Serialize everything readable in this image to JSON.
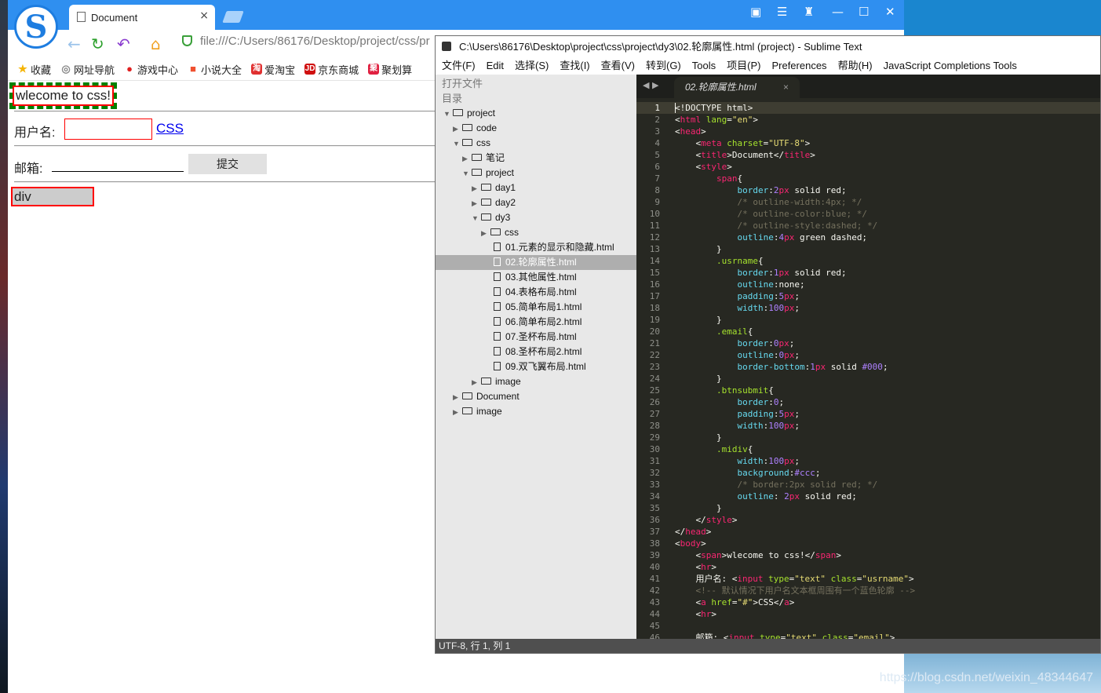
{
  "browser": {
    "tab_title": "Document",
    "tab_close": "×",
    "url": "file:///C:/Users/86176/Desktop/project/css/pr",
    "bookmarks": [
      {
        "label": "收藏",
        "icon": "star-icon",
        "color": "#f5b400"
      },
      {
        "label": "网址导航",
        "icon": "globe-icon",
        "color": "#888888"
      },
      {
        "label": "游戏中心",
        "icon": "game-icon",
        "color": "#e02020"
      },
      {
        "label": "小说大全",
        "icon": "book-icon",
        "color": "#f05030"
      },
      {
        "label": "爱淘宝",
        "icon": "taobao-icon",
        "color": "#e03030"
      },
      {
        "label": "京东商城",
        "icon": "jd-icon",
        "color": "#d01010"
      },
      {
        "label": "聚划算",
        "icon": "juhuasuan-icon",
        "color": "#e02040"
      }
    ],
    "bookmark_glyphs": {
      "taobao": "淘",
      "jd": "JD",
      "juhuasuan": "聚"
    }
  },
  "page": {
    "welcome_text": "wlecome to css!",
    "username_label": "用户名:",
    "css_link": "CSS",
    "email_label": "邮箱:",
    "submit_label": "提交",
    "div_text": "div"
  },
  "sublime": {
    "window_title": "C:\\Users\\86176\\Desktop\\project\\css\\project\\dy3\\02.轮廓属性.html (project) - Sublime Text",
    "menu": [
      "文件(F)",
      "Edit",
      "选择(S)",
      "查找(I)",
      "查看(V)",
      "转到(G)",
      "Tools",
      "项目(P)",
      "Preferences",
      "帮助(H)",
      "JavaScript Completions Tools"
    ],
    "sidebar_headers": {
      "open_files": "打开文件",
      "folders": "目录"
    },
    "tree": [
      {
        "label": "project",
        "type": "folder",
        "depth": 0,
        "open": true
      },
      {
        "label": "code",
        "type": "folder",
        "depth": 1,
        "open": false
      },
      {
        "label": "css",
        "type": "folder",
        "depth": 1,
        "open": true
      },
      {
        "label": "笔记",
        "type": "folder",
        "depth": 2,
        "open": false
      },
      {
        "label": "project",
        "type": "folder",
        "depth": 2,
        "open": true
      },
      {
        "label": "day1",
        "type": "folder",
        "depth": 3,
        "open": false
      },
      {
        "label": "day2",
        "type": "folder",
        "depth": 3,
        "open": false
      },
      {
        "label": "dy3",
        "type": "folder",
        "depth": 3,
        "open": true
      },
      {
        "label": "css",
        "type": "folder",
        "depth": 4,
        "open": false
      },
      {
        "label": "01.元素的显示和隐藏.html",
        "type": "file",
        "depth": 4
      },
      {
        "label": "02.轮廓属性.html",
        "type": "file",
        "depth": 4,
        "selected": true
      },
      {
        "label": "03.其他属性.html",
        "type": "file",
        "depth": 4
      },
      {
        "label": "04.表格布局.html",
        "type": "file",
        "depth": 4
      },
      {
        "label": "05.简单布局1.html",
        "type": "file",
        "depth": 4
      },
      {
        "label": "06.简单布局2.html",
        "type": "file",
        "depth": 4
      },
      {
        "label": "07.圣杯布局.html",
        "type": "file",
        "depth": 4
      },
      {
        "label": "08.圣杯布局2.html",
        "type": "file",
        "depth": 4
      },
      {
        "label": "09.双飞翼布局.html",
        "type": "file",
        "depth": 4
      },
      {
        "label": "image",
        "type": "folder",
        "depth": 3,
        "open": false
      },
      {
        "label": "Document",
        "type": "folder",
        "depth": 1,
        "open": false
      },
      {
        "label": "image",
        "type": "folder",
        "depth": 1,
        "open": false
      }
    ],
    "editor_tab": "02.轮廓属性.html",
    "editor_tab_close": "×",
    "tab_nav": "◀ ▶",
    "status": "UTF-8, 行 1, 列 1"
  },
  "code_lines": [
    [
      [
        "<!DOCTYPE html>",
        "#f8f8f2"
      ]
    ],
    [
      [
        "<",
        "#f8f8f2"
      ],
      [
        "html",
        "#f92672"
      ],
      [
        " lang",
        "#a6e22e"
      ],
      [
        "=",
        "#f8f8f2"
      ],
      [
        "\"en\"",
        "#e6db74"
      ],
      [
        ">",
        "#f8f8f2"
      ]
    ],
    [
      [
        "<",
        "#f8f8f2"
      ],
      [
        "head",
        "#f92672"
      ],
      [
        ">",
        "#f8f8f2"
      ]
    ],
    [
      [
        "    <",
        "#f8f8f2"
      ],
      [
        "meta",
        "#f92672"
      ],
      [
        " charset",
        "#a6e22e"
      ],
      [
        "=",
        "#f8f8f2"
      ],
      [
        "\"UTF-8\"",
        "#e6db74"
      ],
      [
        ">",
        "#f8f8f2"
      ]
    ],
    [
      [
        "    <",
        "#f8f8f2"
      ],
      [
        "title",
        "#f92672"
      ],
      [
        ">Document</",
        "#f8f8f2"
      ],
      [
        "title",
        "#f92672"
      ],
      [
        ">",
        "#f8f8f2"
      ]
    ],
    [
      [
        "    <",
        "#f8f8f2"
      ],
      [
        "style",
        "#f92672"
      ],
      [
        ">",
        "#f8f8f2"
      ]
    ],
    [
      [
        "        ",
        "#f8f8f2"
      ],
      [
        "span",
        "#f92672"
      ],
      [
        "{",
        "#f8f8f2"
      ]
    ],
    [
      [
        "            ",
        "#f8f8f2"
      ],
      [
        "border",
        "#66d9ef"
      ],
      [
        ":",
        "#f8f8f2"
      ],
      [
        "2",
        "#ae81ff"
      ],
      [
        "px",
        "#f92672"
      ],
      [
        " solid red;",
        "#f8f8f2"
      ]
    ],
    [
      [
        "            /* outline-width:4px; */",
        "#75715e"
      ]
    ],
    [
      [
        "            /* outline-color:blue; */",
        "#75715e"
      ]
    ],
    [
      [
        "            /* outline-style:dashed; */",
        "#75715e"
      ]
    ],
    [
      [
        "            ",
        "#f8f8f2"
      ],
      [
        "outline",
        "#66d9ef"
      ],
      [
        ":",
        "#f8f8f2"
      ],
      [
        "4",
        "#ae81ff"
      ],
      [
        "px",
        "#f92672"
      ],
      [
        " green dashed;",
        "#f8f8f2"
      ]
    ],
    [
      [
        "        }",
        "#f8f8f2"
      ]
    ],
    [
      [
        "        ",
        "#f8f8f2"
      ],
      [
        ".usrname",
        "#a6e22e"
      ],
      [
        "{",
        "#f8f8f2"
      ]
    ],
    [
      [
        "            ",
        "#f8f8f2"
      ],
      [
        "border",
        "#66d9ef"
      ],
      [
        ":",
        "#f8f8f2"
      ],
      [
        "1",
        "#ae81ff"
      ],
      [
        "px",
        "#f92672"
      ],
      [
        " solid red;",
        "#f8f8f2"
      ]
    ],
    [
      [
        "            ",
        "#f8f8f2"
      ],
      [
        "outline",
        "#66d9ef"
      ],
      [
        ":none;",
        "#f8f8f2"
      ]
    ],
    [
      [
        "            ",
        "#f8f8f2"
      ],
      [
        "padding",
        "#66d9ef"
      ],
      [
        ":",
        "#f8f8f2"
      ],
      [
        "5",
        "#ae81ff"
      ],
      [
        "px",
        "#f92672"
      ],
      [
        ";",
        "#f8f8f2"
      ]
    ],
    [
      [
        "            ",
        "#f8f8f2"
      ],
      [
        "width",
        "#66d9ef"
      ],
      [
        ":",
        "#f8f8f2"
      ],
      [
        "100",
        "#ae81ff"
      ],
      [
        "px",
        "#f92672"
      ],
      [
        ";",
        "#f8f8f2"
      ]
    ],
    [
      [
        "        }",
        "#f8f8f2"
      ]
    ],
    [
      [
        "        ",
        "#f8f8f2"
      ],
      [
        ".email",
        "#a6e22e"
      ],
      [
        "{",
        "#f8f8f2"
      ]
    ],
    [
      [
        "            ",
        "#f8f8f2"
      ],
      [
        "border",
        "#66d9ef"
      ],
      [
        ":",
        "#f8f8f2"
      ],
      [
        "0",
        "#ae81ff"
      ],
      [
        "px",
        "#f92672"
      ],
      [
        ";",
        "#f8f8f2"
      ]
    ],
    [
      [
        "            ",
        "#f8f8f2"
      ],
      [
        "outline",
        "#66d9ef"
      ],
      [
        ":",
        "#f8f8f2"
      ],
      [
        "0",
        "#ae81ff"
      ],
      [
        "px",
        "#f92672"
      ],
      [
        ";",
        "#f8f8f2"
      ]
    ],
    [
      [
        "            ",
        "#f8f8f2"
      ],
      [
        "border-bottom",
        "#66d9ef"
      ],
      [
        ":",
        "#f8f8f2"
      ],
      [
        "1",
        "#ae81ff"
      ],
      [
        "px",
        "#f92672"
      ],
      [
        " solid ",
        "#f8f8f2"
      ],
      [
        "#000",
        "#ae81ff"
      ],
      [
        ";",
        "#f8f8f2"
      ]
    ],
    [
      [
        "        }",
        "#f8f8f2"
      ]
    ],
    [
      [
        "        ",
        "#f8f8f2"
      ],
      [
        ".btnsubmit",
        "#a6e22e"
      ],
      [
        "{",
        "#f8f8f2"
      ]
    ],
    [
      [
        "            ",
        "#f8f8f2"
      ],
      [
        "border",
        "#66d9ef"
      ],
      [
        ":",
        "#f8f8f2"
      ],
      [
        "0",
        "#ae81ff"
      ],
      [
        ";",
        "#f8f8f2"
      ]
    ],
    [
      [
        "            ",
        "#f8f8f2"
      ],
      [
        "padding",
        "#66d9ef"
      ],
      [
        ":",
        "#f8f8f2"
      ],
      [
        "5",
        "#ae81ff"
      ],
      [
        "px",
        "#f92672"
      ],
      [
        ";",
        "#f8f8f2"
      ]
    ],
    [
      [
        "            ",
        "#f8f8f2"
      ],
      [
        "width",
        "#66d9ef"
      ],
      [
        ":",
        "#f8f8f2"
      ],
      [
        "100",
        "#ae81ff"
      ],
      [
        "px",
        "#f92672"
      ],
      [
        ";",
        "#f8f8f2"
      ]
    ],
    [
      [
        "        }",
        "#f8f8f2"
      ]
    ],
    [
      [
        "        ",
        "#f8f8f2"
      ],
      [
        ".midiv",
        "#a6e22e"
      ],
      [
        "{",
        "#f8f8f2"
      ]
    ],
    [
      [
        "            ",
        "#f8f8f2"
      ],
      [
        "width",
        "#66d9ef"
      ],
      [
        ":",
        "#f8f8f2"
      ],
      [
        "100",
        "#ae81ff"
      ],
      [
        "px",
        "#f92672"
      ],
      [
        ";",
        "#f8f8f2"
      ]
    ],
    [
      [
        "            ",
        "#f8f8f2"
      ],
      [
        "background",
        "#66d9ef"
      ],
      [
        ":",
        "#f8f8f2"
      ],
      [
        "#ccc",
        "#ae81ff"
      ],
      [
        ";",
        "#f8f8f2"
      ]
    ],
    [
      [
        "            /* border:2px solid red; */",
        "#75715e"
      ]
    ],
    [
      [
        "            ",
        "#f8f8f2"
      ],
      [
        "outline",
        "#66d9ef"
      ],
      [
        ": ",
        "#f8f8f2"
      ],
      [
        "2",
        "#ae81ff"
      ],
      [
        "px",
        "#f92672"
      ],
      [
        " solid red;",
        "#f8f8f2"
      ]
    ],
    [
      [
        "        }",
        "#f8f8f2"
      ]
    ],
    [
      [
        "    </",
        "#f8f8f2"
      ],
      [
        "style",
        "#f92672"
      ],
      [
        ">",
        "#f8f8f2"
      ]
    ],
    [
      [
        "</",
        "#f8f8f2"
      ],
      [
        "head",
        "#f92672"
      ],
      [
        ">",
        "#f8f8f2"
      ]
    ],
    [
      [
        "<",
        "#f8f8f2"
      ],
      [
        "body",
        "#f92672"
      ],
      [
        ">",
        "#f8f8f2"
      ]
    ],
    [
      [
        "    <",
        "#f8f8f2"
      ],
      [
        "span",
        "#f92672"
      ],
      [
        ">wlecome to css!</",
        "#f8f8f2"
      ],
      [
        "span",
        "#f92672"
      ],
      [
        ">",
        "#f8f8f2"
      ]
    ],
    [
      [
        "    <",
        "#f8f8f2"
      ],
      [
        "hr",
        "#f92672"
      ],
      [
        ">",
        "#f8f8f2"
      ]
    ],
    [
      [
        "    用户名: <",
        "#f8f8f2"
      ],
      [
        "input",
        "#f92672"
      ],
      [
        " type",
        "#a6e22e"
      ],
      [
        "=",
        "#f8f8f2"
      ],
      [
        "\"text\"",
        "#e6db74"
      ],
      [
        " class",
        "#a6e22e"
      ],
      [
        "=",
        "#f8f8f2"
      ],
      [
        "\"usrname\"",
        "#e6db74"
      ],
      [
        ">",
        "#f8f8f2"
      ]
    ],
    [
      [
        "    <!-- 默认情况下用户名文本框周围有一个蓝色轮廓 -->",
        "#75715e"
      ]
    ],
    [
      [
        "    <",
        "#f8f8f2"
      ],
      [
        "a",
        "#f92672"
      ],
      [
        " href",
        "#a6e22e"
      ],
      [
        "=",
        "#f8f8f2"
      ],
      [
        "\"#\"",
        "#e6db74"
      ],
      [
        ">CSS</",
        "#f8f8f2"
      ],
      [
        "a",
        "#f92672"
      ],
      [
        ">",
        "#f8f8f2"
      ]
    ],
    [
      [
        "    <",
        "#f8f8f2"
      ],
      [
        "hr",
        "#f92672"
      ],
      [
        ">",
        "#f8f8f2"
      ]
    ],
    [
      [
        "",
        "#f8f8f2"
      ]
    ],
    [
      [
        "    邮箱: <",
        "#f8f8f2"
      ],
      [
        "input",
        "#f92672"
      ],
      [
        " type",
        "#a6e22e"
      ],
      [
        "=",
        "#f8f8f2"
      ],
      [
        "\"text\"",
        "#e6db74"
      ],
      [
        " class",
        "#a6e22e"
      ],
      [
        "=",
        "#f8f8f2"
      ],
      [
        "\"email\"",
        "#e6db74"
      ],
      [
        ">",
        "#f8f8f2"
      ]
    ]
  ],
  "watermark": "https://blog.csdn.net/weixin_48344647"
}
